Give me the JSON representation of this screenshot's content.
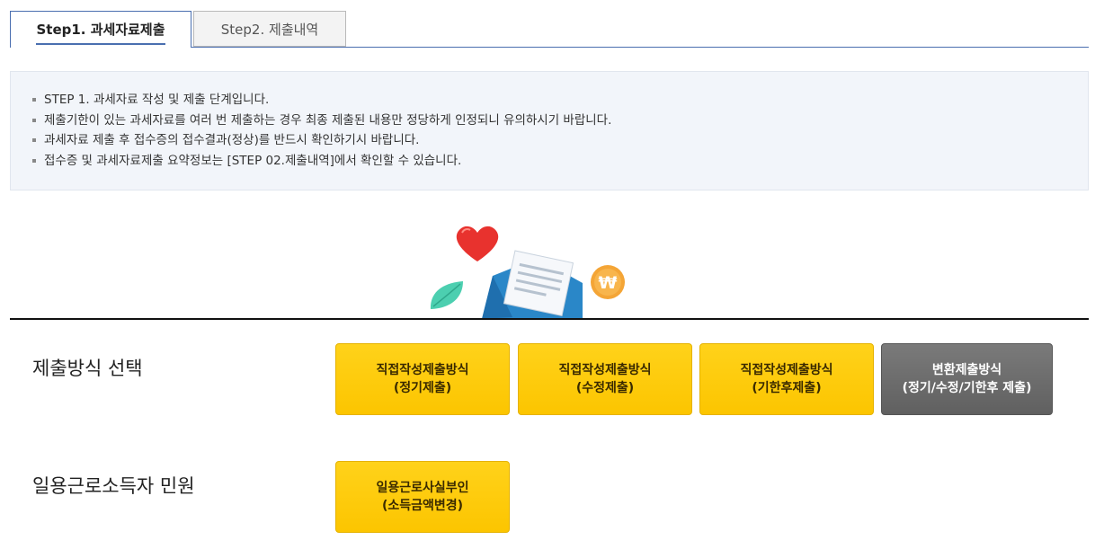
{
  "tabs": [
    {
      "label": "Step1. 과세자료제출",
      "active": true
    },
    {
      "label": "Step2. 제출내역",
      "active": false
    }
  ],
  "notice": {
    "items": [
      "STEP 1. 과세자료 작성 및 제출 단계입니다.",
      "제출기한이 있는 과세자료를 여러 번 제출하는 경우 최종 제출된 내용만 정당하게 인정되니 유의하시기 바랍니다.",
      "과세자료 제출 후 접수증의 접수결과(정상)를 반드시 확인하기시 바랍니다.",
      "접수증 및 과세자료제출 요약정보는 [STEP 02.제출내역]에서 확인할 수 있습니다."
    ]
  },
  "illustration": {
    "won_symbol": "₩",
    "icons": [
      "heart-icon",
      "envelope-icon",
      "leaf-icon",
      "won-coin-icon"
    ]
  },
  "submission_method": {
    "label": "제출방식 선택",
    "buttons": [
      {
        "line1": "직접작성제출방식",
        "line2": "(정기제출)",
        "style": "yellow"
      },
      {
        "line1": "직접작성제출방식",
        "line2": "(수정제출)",
        "style": "yellow"
      },
      {
        "line1": "직접작성제출방식",
        "line2": "(기한후제출)",
        "style": "yellow"
      },
      {
        "line1": "변환제출방식",
        "line2": "(정기/수정/기한후 제출)",
        "style": "gray"
      }
    ]
  },
  "daily_worker": {
    "label": "일용근로소득자 민원",
    "buttons": [
      {
        "line1": "일용근로사실부인",
        "line2": "(소득금액변경)",
        "style": "yellow"
      }
    ]
  },
  "colors": {
    "tab_accent": "#4a6fb0",
    "button_yellow": "#fcc500",
    "button_gray": "#6b6b6b",
    "notice_bg": "#f2f5fa"
  }
}
